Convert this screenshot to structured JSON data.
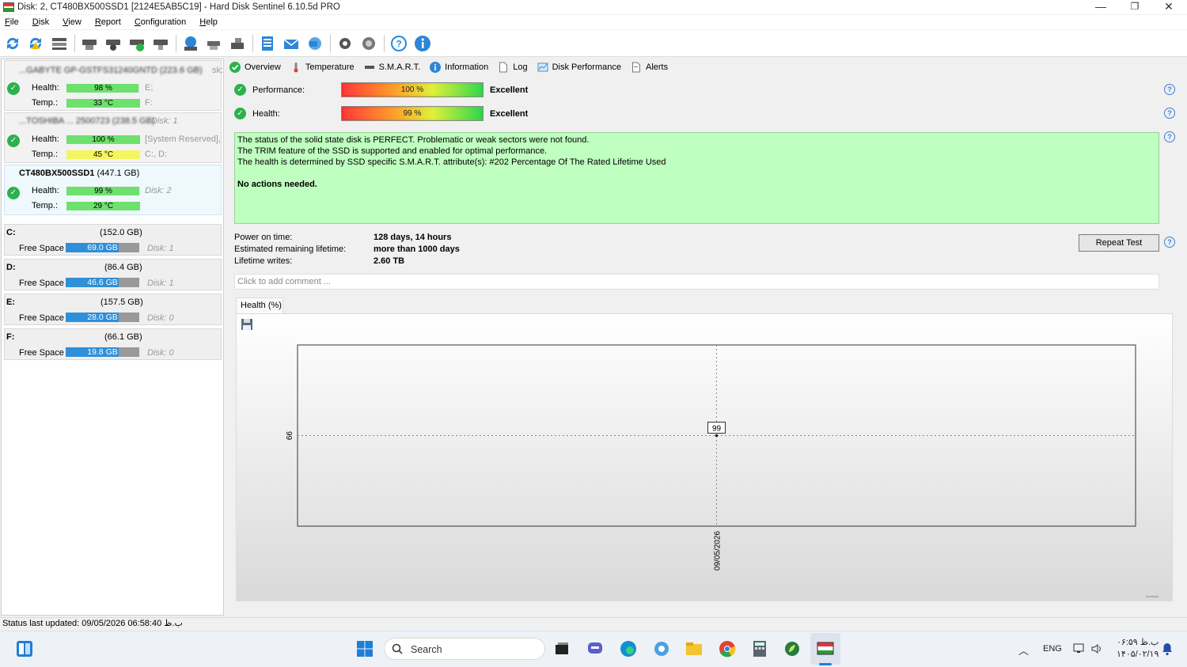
{
  "window": {
    "title": "Disk: 2, CT480BX500SSD1 [2124E5AB5C19]  -  Hard Disk Sentinel 6.10.5d PRO",
    "controls": {
      "minimize": "—",
      "restore": "❐",
      "close": "✕"
    }
  },
  "menu": [
    {
      "u": "F",
      "rest": "ile"
    },
    {
      "u": "D",
      "rest": "isk"
    },
    {
      "u": "V",
      "rest": "iew"
    },
    {
      "u": "R",
      "rest": "eport"
    },
    {
      "u": "C",
      "rest": "onfiguration"
    },
    {
      "u": "H",
      "rest": "elp"
    }
  ],
  "disks": [
    {
      "name_blurred": "...GABYTE GP-GSTFS31240GNTD (223.6 GB)",
      "side_note": "sk:",
      "health_label": "Health:",
      "health": "98 %",
      "health_pct": 98,
      "temp_label": "Temp.:",
      "temp": "33 °C",
      "right1": "E;",
      "right2": "F:"
    },
    {
      "name_blurred": "...TOSHIBA ... 2500723 (238.5 GB)",
      "side_note": "Disk: 1",
      "health_label": "Health:",
      "health": "100 %",
      "health_pct": 100,
      "temp_label": "Temp.:",
      "temp": "45 °C",
      "right1": "[System Reserved],",
      "right2": "C:, D:"
    },
    {
      "name": "CT480BX500SSD1",
      "size": "(447.1 GB)",
      "health_label": "Health:",
      "health": "99 %",
      "health_pct": 99,
      "temp_label": "Temp.:",
      "temp": "29 °C",
      "right1": "Disk: 2",
      "right2": ""
    }
  ],
  "volumes": [
    {
      "letter": "C:",
      "size": "(152.0 GB)",
      "free_label": "Free Space",
      "free": "69.0 GB",
      "free_pct": 45,
      "disk": "Disk: 1"
    },
    {
      "letter": "D:",
      "size": "(86.4 GB)",
      "free_label": "Free Space",
      "free": "46.6 GB",
      "free_pct": 54,
      "disk": "Disk: 1"
    },
    {
      "letter": "E:",
      "size": "(157.5 GB)",
      "free_label": "Free Space",
      "free": "28.0 GB",
      "free_pct": 18,
      "disk": "Disk: 0"
    },
    {
      "letter": "F:",
      "size": "(66.1 GB)",
      "free_label": "Free Space",
      "free": "19.8 GB",
      "free_pct": 30,
      "disk": "Disk: 0"
    }
  ],
  "tabs": [
    "Overview",
    "Temperature",
    "S.M.A.R.T.",
    "Information",
    "Log",
    "Disk Performance",
    "Alerts"
  ],
  "overview": {
    "performance_label": "Performance:",
    "performance": "100 %",
    "performance_pct": 100,
    "performance_rating": "Excellent",
    "health_label": "Health:",
    "health": "99 %",
    "health_pct": 99,
    "health_rating": "Excellent",
    "status_lines": [
      "The status of the solid state disk is PERFECT. Problematic or weak sectors were not found.",
      "The TRIM feature of the SSD is supported and enabled for optimal performance.",
      "The health is determined by SSD specific S.M.A.R.T. attribute(s):  #202 Percentage Of The Rated Lifetime Used"
    ],
    "actions": "No actions needed.",
    "power_on_label": "Power on time:",
    "power_on": "128 days, 14 hours",
    "remaining_label": "Estimated remaining lifetime:",
    "remaining": "more than 1000 days",
    "writes_label": "Lifetime writes:",
    "writes": "2.60 TB",
    "repeat_test": "Repeat Test",
    "comment_placeholder": "Click to add comment ...",
    "chart_tab": "Health (%)"
  },
  "chart_data": {
    "type": "scatter",
    "x": [
      "09/05/2026"
    ],
    "y": [
      99
    ],
    "point_label": "99",
    "ylabel_tick": "99",
    "xlabel_tick": "09/05/2026",
    "grid": true
  },
  "status_bar": "Status last updated: 09/05/2026 06:58:40 ب.ظ",
  "taskbar": {
    "search": "Search",
    "lang": "ENG",
    "time": "ب.ظ ۰۶:۵۹",
    "date": "۱۴۰۵/۰۲/۱۹"
  },
  "colors": {
    "ok_green": "#2bb24c",
    "status_bg": "#bfffbf",
    "accent_blue": "#2f8fd8",
    "health_bar": "#6ee06e",
    "temp_warm": "#f5f560"
  }
}
